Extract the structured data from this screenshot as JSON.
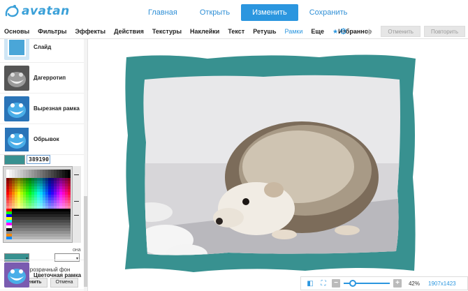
{
  "brand": {
    "name": "avatan",
    "accent": "#2b96df"
  },
  "nav": [
    {
      "label": "Главная"
    },
    {
      "label": "Открыть"
    },
    {
      "label": "Изменить"
    },
    {
      "label": "Сохранить"
    }
  ],
  "tools": [
    {
      "label": "Основы"
    },
    {
      "label": "Фильтры"
    },
    {
      "label": "Эффекты"
    },
    {
      "label": "Действия"
    },
    {
      "label": "Текстуры"
    },
    {
      "label": "Наклейки"
    },
    {
      "label": "Текст"
    },
    {
      "label": "Ретушь"
    },
    {
      "label": "Рамки"
    },
    {
      "label": "Еще"
    },
    {
      "label": "Избранное"
    }
  ],
  "toolbar": {
    "undo_label": "Отменить",
    "redo_label": "Повторить"
  },
  "effects": [
    {
      "label": "Слайд"
    },
    {
      "label": "Дагерротип"
    },
    {
      "label": "Вырезная рамка"
    },
    {
      "label": "Обрывок"
    },
    {
      "label": "Цветочная рамка"
    }
  ],
  "picker": {
    "hex_value": "389190",
    "current_color": "#389190",
    "edge_text": "она",
    "transparent_label": "Прозрачный фон",
    "apply_label": "Применить",
    "cancel_label": "Отмена"
  },
  "frame": {
    "color": "#389190"
  },
  "statusbar": {
    "zoom": "42%",
    "zoom_fraction": 0.42,
    "dimensions": "1907x1423"
  }
}
